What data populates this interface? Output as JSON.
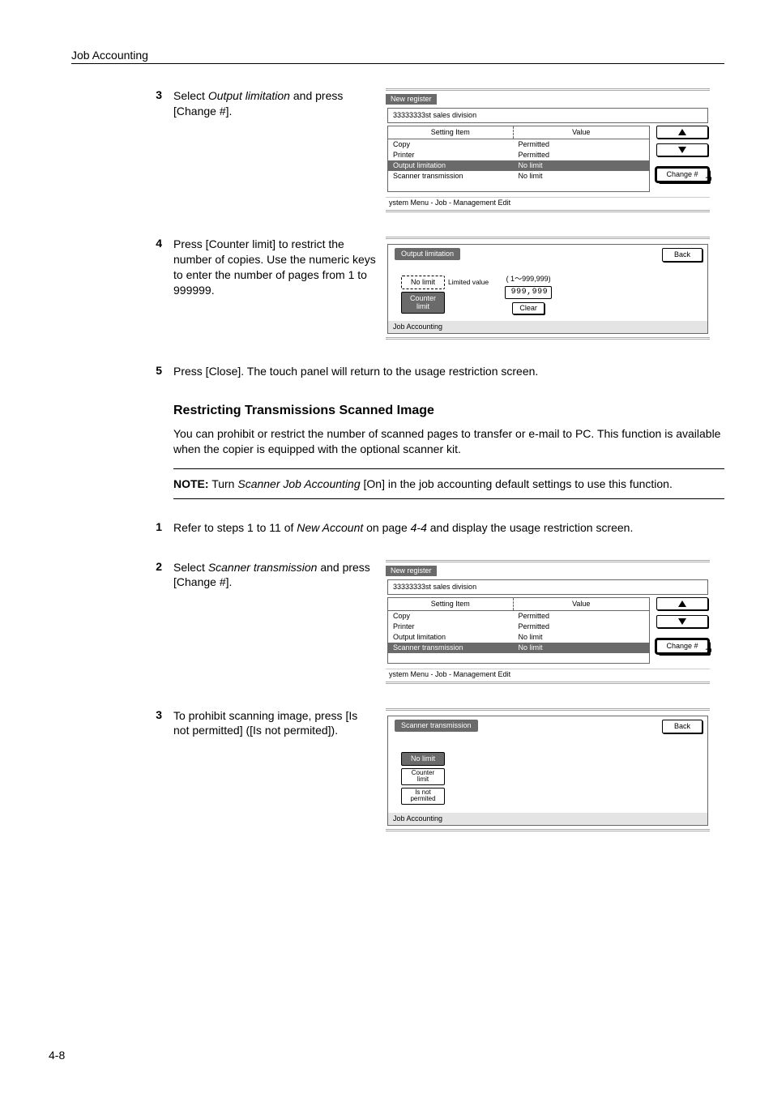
{
  "header": {
    "section_title": "Job Accounting"
  },
  "page_number": "4-8",
  "xref_page": "4-4",
  "steps": {
    "s3a": {
      "num": "3",
      "text_pre": "Select ",
      "text_ital": "Output limitation",
      "text_post": " and press [Change #]."
    },
    "s4": {
      "num": "4",
      "text": "Press [Counter limit] to restrict the number of copies. Use the numeric keys to enter the number of pages from 1 to 999999."
    },
    "s5": {
      "num": "5",
      "text": "Press [Close]. The touch panel will return to the usage restriction screen."
    },
    "s1": {
      "num": "1",
      "text_pre": "Refer to steps 1 to 11 of ",
      "text_ital": "New Account",
      "text_mid": " on page ",
      "text_ital2": "4-4",
      "text_post": " and display the usage restriction screen."
    },
    "s2": {
      "num": "2",
      "text_pre": "Select ",
      "text_ital": "Scanner transmission",
      "text_post": " and press [Change #]."
    },
    "s3b": {
      "num": "3",
      "text": "To prohibit scanning image, press [Is not permitted] ([Is not permited])."
    }
  },
  "section": {
    "title": "Restricting Transmissions Scanned Image",
    "body": "You can prohibit or restrict the number of scanned pages to transfer or e-mail to PC. This function is available when the copier is equipped with the optional scanner kit."
  },
  "note": {
    "label": "NOTE:",
    "text_pre": " Turn ",
    "text_ital": "Scanner Job Accounting",
    "text_post": " [On] in the job accounting default settings to use this function."
  },
  "panelA": {
    "tab": "New register",
    "subtitle": "33333333st sales division",
    "col1": "Setting Item",
    "col2": "Value",
    "rows": [
      {
        "label": "Copy",
        "value": "Permitted",
        "sel": false
      },
      {
        "label": "Printer",
        "value": "Permitted",
        "sel": false
      },
      {
        "label": "Output limitation",
        "value": "No limit",
        "sel": true
      },
      {
        "label": "Scanner transmission",
        "value": "No limit",
        "sel": false
      }
    ],
    "change_btn": "Change #",
    "breadcrumb": "ystem Menu     -  Job              -  Management Edit"
  },
  "panelB": {
    "title": "Output limitation",
    "back": "Back",
    "range": "( 1～999,999)",
    "value": "999,999",
    "opts": {
      "no_limit": "No limit",
      "counter_limit": "Counter limit",
      "limited": "Limited value",
      "clear": "Clear"
    },
    "footer": "Job Accounting"
  },
  "panelC": {
    "tab": "New register",
    "subtitle": "33333333st sales division",
    "col1": "Setting Item",
    "col2": "Value",
    "rows": [
      {
        "label": "Copy",
        "value": "Permitted",
        "sel": false
      },
      {
        "label": "Printer",
        "value": "Permitted",
        "sel": false
      },
      {
        "label": "Output limitation",
        "value": "No limit",
        "sel": false
      },
      {
        "label": "Scanner transmission",
        "value": "No limit",
        "sel": true
      }
    ],
    "change_btn": "Change #",
    "breadcrumb": "ystem Menu     -  Job              -  Management Edit"
  },
  "panelD": {
    "title": "Scanner transmission",
    "back": "Back",
    "opts": {
      "no_limit": "No limit",
      "counter_limit": "Counter limit",
      "not_permitted": "Is not permited"
    },
    "footer": "Job Accounting"
  }
}
